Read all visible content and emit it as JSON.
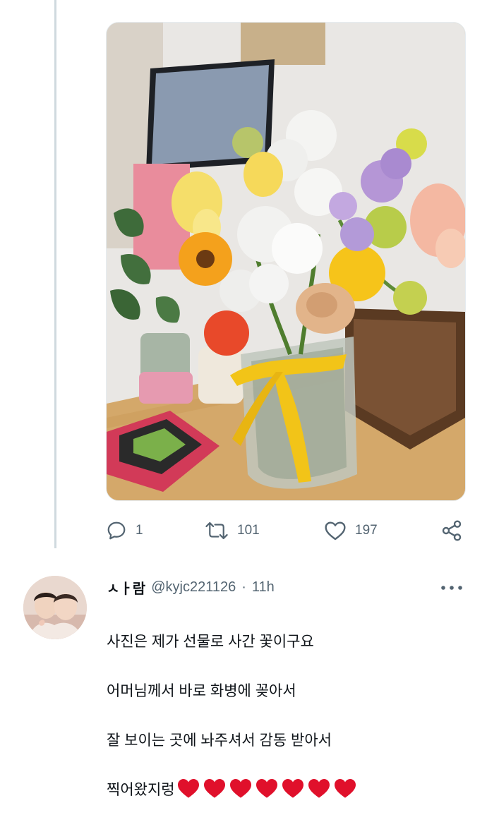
{
  "tweet": {
    "photo": {
      "alt_icon": "flower-bouquet-photo",
      "colors": {
        "background": "#cbb89e",
        "table": "#d4a86a",
        "wall": "#e9e7e4",
        "ribbon": "#f2c418"
      }
    },
    "actions": {
      "reply_count": "1",
      "retweet_count": "101",
      "like_count": "197",
      "icons": [
        "reply-icon",
        "retweet-icon",
        "like-icon",
        "share-icon"
      ]
    }
  },
  "reply": {
    "display_name": "ㅅㅏ람",
    "handle": "@kyjc221126",
    "separator": "·",
    "time": "11h",
    "lines": [
      "사진은 제가 선물로 사간 꽃이구요",
      "어머님께서 바로 화병에 꽂아서",
      "잘 보이는 곳에 놔주셔서 감동 받아서",
      "찍어왔지렁"
    ],
    "hearts": 7,
    "heart_color": "#e0102b"
  },
  "colors": {
    "muted": "#536471",
    "thread_line": "#cfd9de",
    "text": "#0f1419"
  }
}
